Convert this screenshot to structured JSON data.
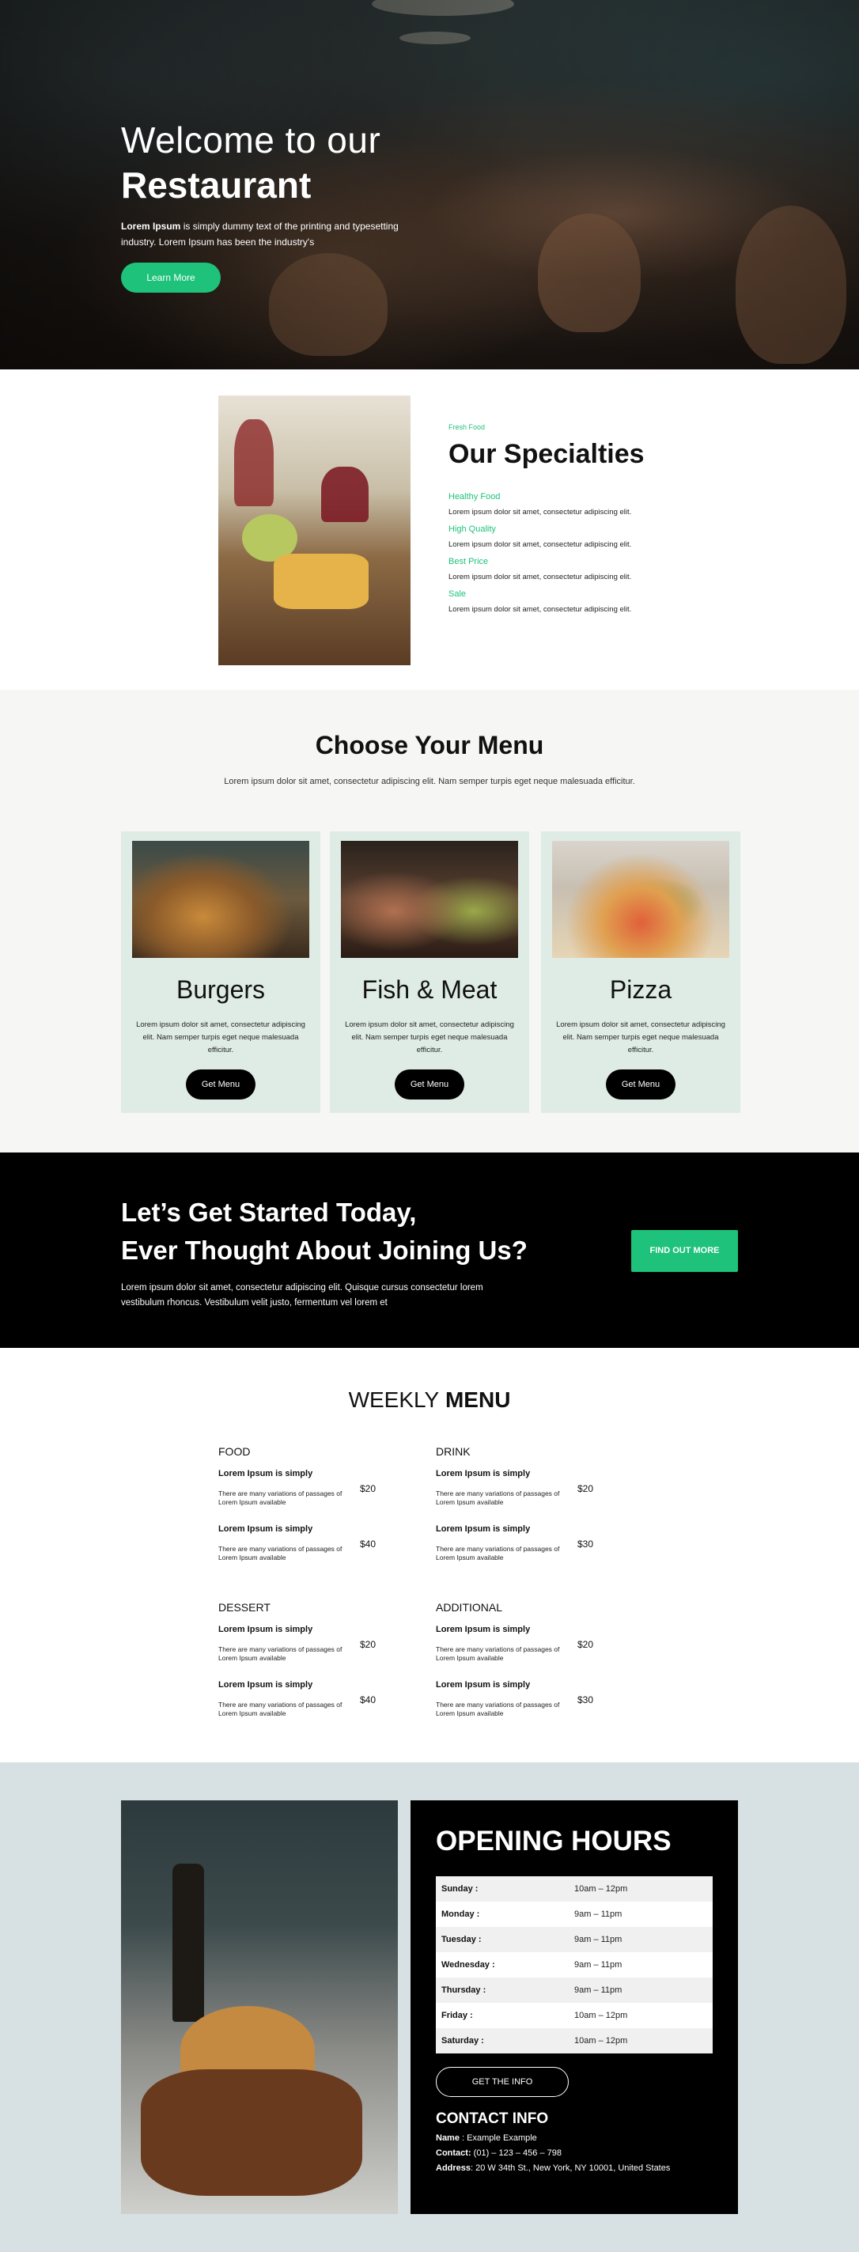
{
  "hero": {
    "title_line1": "Welcome to our",
    "title_line2": "Restaurant",
    "text_bold": "Lorem Ipsum",
    "text_rest": " is simply dummy text of the printing and typesetting industry. Lorem Ipsum has been the industry's",
    "button": "Learn More",
    "colors": {
      "accent": "#1ec27a"
    }
  },
  "specialties": {
    "tag": "Fresh Food",
    "title": "Our Specialties",
    "items": [
      {
        "heading": "Healthy Food",
        "text": "Lorem ipsum dolor sit amet, consectetur adipiscing elit."
      },
      {
        "heading": "High Quality",
        "text": "Lorem ipsum dolor sit amet, consectetur adipiscing elit."
      },
      {
        "heading": "Best Price",
        "text": "Lorem ipsum dolor sit amet, consectetur adipiscing elit."
      },
      {
        "heading": "Sale",
        "text": "Lorem ipsum dolor sit amet, consectetur adipiscing elit."
      }
    ]
  },
  "choose": {
    "title": "Choose Your Menu",
    "subtitle": "Lorem ipsum dolor sit amet, consectetur adipiscing elit. Nam semper turpis eget neque malesuada efficitur.",
    "cards": [
      {
        "name": "Burgers",
        "desc": "Lorem ipsum dolor sit amet, consectetur adipiscing elit. Nam semper turpis eget neque malesuada efficitur.",
        "button": "Get Menu"
      },
      {
        "name": "Fish & Meat",
        "desc": "Lorem ipsum dolor sit amet, consectetur adipiscing elit. Nam semper turpis eget neque malesuada efficitur.",
        "button": "Get Menu"
      },
      {
        "name": "Pizza",
        "desc": "Lorem ipsum dolor sit amet, consectetur adipiscing elit. Nam semper turpis eget neque malesuada efficitur.",
        "button": "Get Menu"
      }
    ]
  },
  "cta": {
    "title_line1": "Let’s Get Started Today,",
    "title_line2": "Ever Thought About Joining Us?",
    "text": "Lorem ipsum dolor sit amet, consectetur adipiscing elit. Quisque cursus consectetur lorem vestibulum rhoncus. Vestibulum velit justo, fermentum vel lorem et",
    "button": "FIND OUT MORE"
  },
  "weekly": {
    "title_light": "WEEKLY",
    "title_bold": "MENU",
    "sections": [
      {
        "heading": "FOOD",
        "items": [
          {
            "name": "Lorem Ipsum is simply",
            "desc": "There are many variations of passages of Lorem Ipsum available",
            "price": "$20"
          },
          {
            "name": "Lorem Ipsum is simply",
            "desc": "There are many variations of passages of Lorem Ipsum available",
            "price": "$40"
          }
        ]
      },
      {
        "heading": "DRINK",
        "items": [
          {
            "name": "Lorem Ipsum is simply",
            "desc": "There are many variations of passages of Lorem Ipsum available",
            "price": "$20"
          },
          {
            "name": "Lorem Ipsum is simply",
            "desc": "There are many variations of passages of Lorem Ipsum available",
            "price": "$30"
          }
        ]
      },
      {
        "heading": "DESSERT",
        "items": [
          {
            "name": "Lorem Ipsum is simply",
            "desc": "There are many variations of passages of Lorem Ipsum available",
            "price": "$20"
          },
          {
            "name": "Lorem Ipsum is simply",
            "desc": "There are many variations of passages of Lorem Ipsum available",
            "price": "$40"
          }
        ]
      },
      {
        "heading": "ADDITIONAL",
        "items": [
          {
            "name": "Lorem Ipsum is simply",
            "desc": "There are many variations of passages of Lorem Ipsum available",
            "price": "$20"
          },
          {
            "name": "Lorem Ipsum is simply",
            "desc": "There are many variations of passages of Lorem Ipsum available",
            "price": "$30"
          }
        ]
      }
    ]
  },
  "hours": {
    "title": "OPENING HOURS",
    "rows": [
      {
        "day": "Sunday :",
        "time": "10am – 12pm"
      },
      {
        "day": "Monday :",
        "time": "9am – 11pm"
      },
      {
        "day": "Tuesday :",
        "time": "9am – 11pm"
      },
      {
        "day": "Wednesday :",
        "time": "9am – 11pm"
      },
      {
        "day": "Thursday :",
        "time": "9am – 11pm"
      },
      {
        "day": "Friday :",
        "time": "10am – 12pm"
      },
      {
        "day": "Saturday :",
        "time": "10am – 12pm"
      }
    ],
    "button": "GET THE INFO",
    "contact_title": "CONTACT INFO",
    "contact": {
      "name_label": "Name",
      "name": " : Example Example",
      "contact_label": "Contact:",
      "contact": " (01) – 123 – 456 – 798",
      "address_label": "Address",
      "address": ": 20 W 34th St., New York, NY 10001, United States"
    }
  }
}
